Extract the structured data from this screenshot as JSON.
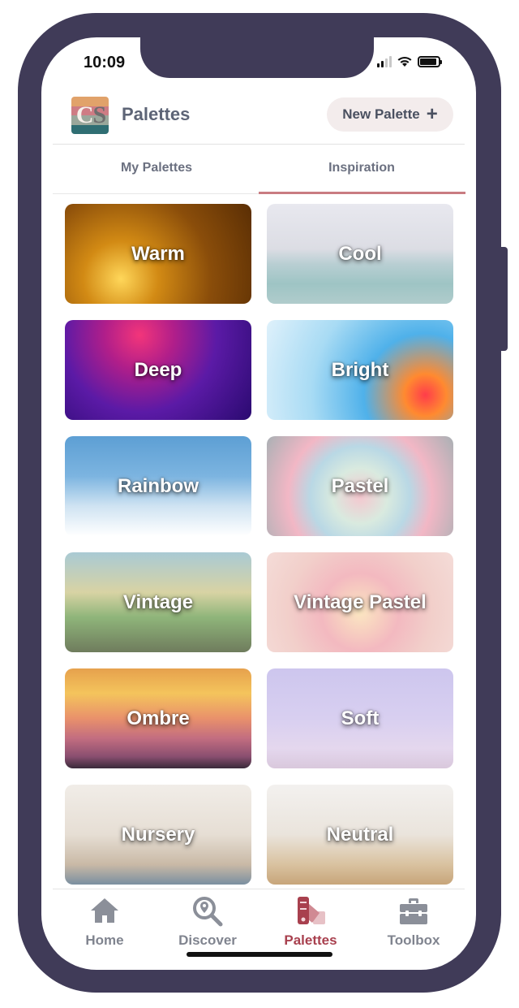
{
  "status": {
    "time": "10:09"
  },
  "header": {
    "logo_text": "CS",
    "logo_colors": [
      "#e1a26a",
      "#ce7c84",
      "#9aa79b",
      "#2f6e73"
    ],
    "title": "Palettes",
    "new_button_label": "New Palette",
    "new_button_icon": "plus-icon"
  },
  "tabs": [
    {
      "label": "My Palettes",
      "active": false
    },
    {
      "label": "Inspiration",
      "active": true
    }
  ],
  "categories": [
    {
      "label": "Warm"
    },
    {
      "label": "Cool"
    },
    {
      "label": "Deep"
    },
    {
      "label": "Bright"
    },
    {
      "label": "Rainbow"
    },
    {
      "label": "Pastel"
    },
    {
      "label": "Vintage"
    },
    {
      "label": "Vintage Pastel"
    },
    {
      "label": "Ombre"
    },
    {
      "label": "Soft"
    },
    {
      "label": "Nursery"
    },
    {
      "label": "Neutral"
    }
  ],
  "nav": [
    {
      "label": "Home",
      "icon": "home-icon",
      "active": false
    },
    {
      "label": "Discover",
      "icon": "discover-icon",
      "active": false
    },
    {
      "label": "Palettes",
      "icon": "palettes-icon",
      "active": true
    },
    {
      "label": "Toolbox",
      "icon": "toolbox-icon",
      "active": false
    }
  ],
  "colors": {
    "frame": "#403b58",
    "accent": "#a8404e",
    "tab_underline": "#c97c82",
    "nav_inactive": "#80848f"
  }
}
